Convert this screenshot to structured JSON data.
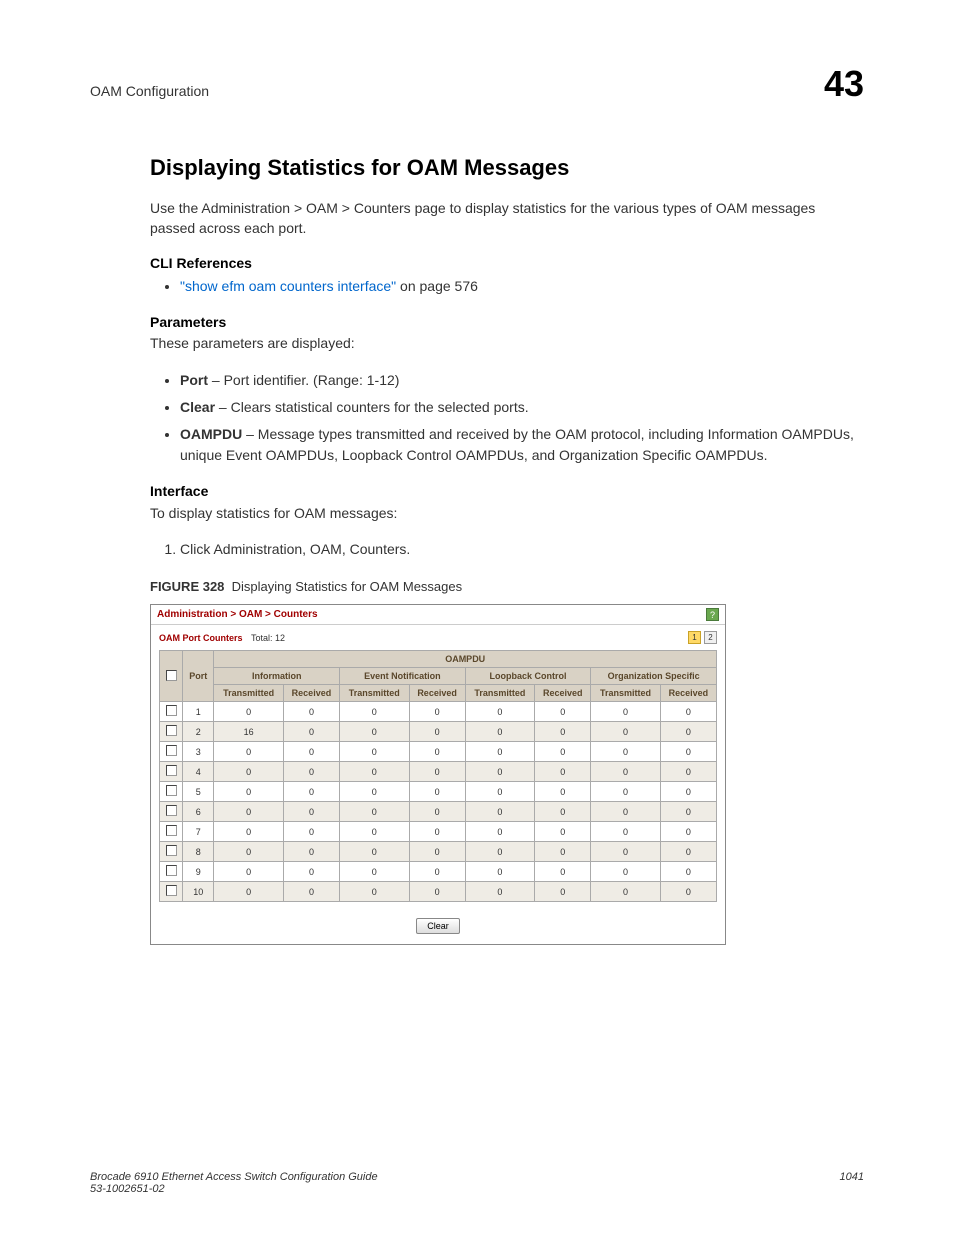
{
  "header": {
    "section": "OAM Configuration",
    "chapter": "43"
  },
  "title": "Displaying Statistics for OAM Messages",
  "intro": "Use the Administration > OAM > Counters page to display statistics for the various types of OAM messages passed across each port.",
  "cli": {
    "heading": "CLI References",
    "link": "\"show efm oam counters interface\"",
    "suffix": " on page 576"
  },
  "params": {
    "heading": "Parameters",
    "intro": "These parameters are displayed:",
    "items": [
      {
        "name": "Port",
        "desc": " – Port identifier. (Range: 1-12)"
      },
      {
        "name": "Clear",
        "desc": " – Clears statistical counters for the selected ports."
      },
      {
        "name": "OAMPDU",
        "desc": " – Message types transmitted and received by the OAM protocol, including Information OAMPDUs, unique Event OAMPDUs, Loopback Control OAMPDUs, and Organization Specific OAMPDUs."
      }
    ]
  },
  "interface": {
    "heading": "Interface",
    "intro": "To display statistics for OAM messages:",
    "steps": [
      "Click Administration, OAM, Counters."
    ]
  },
  "figure": {
    "label": "FIGURE 328",
    "caption": "Displaying Statistics for OAM Messages",
    "breadcrumb": "Administration > OAM > Counters",
    "help": "?",
    "countersLabel": "OAM Port Counters",
    "totalLabel": "Total: 12",
    "pageBadges": [
      "1",
      "2"
    ],
    "headers": {
      "oampdu": "OAMPDU",
      "port": "Port",
      "groups": [
        "Information",
        "Event Notification",
        "Loopback Control",
        "Organization Specific"
      ],
      "sub": [
        "Transmitted",
        "Received"
      ]
    },
    "rows": [
      {
        "port": "1",
        "v": [
          "0",
          "0",
          "0",
          "0",
          "0",
          "0",
          "0",
          "0"
        ]
      },
      {
        "port": "2",
        "v": [
          "16",
          "0",
          "0",
          "0",
          "0",
          "0",
          "0",
          "0"
        ]
      },
      {
        "port": "3",
        "v": [
          "0",
          "0",
          "0",
          "0",
          "0",
          "0",
          "0",
          "0"
        ]
      },
      {
        "port": "4",
        "v": [
          "0",
          "0",
          "0",
          "0",
          "0",
          "0",
          "0",
          "0"
        ]
      },
      {
        "port": "5",
        "v": [
          "0",
          "0",
          "0",
          "0",
          "0",
          "0",
          "0",
          "0"
        ]
      },
      {
        "port": "6",
        "v": [
          "0",
          "0",
          "0",
          "0",
          "0",
          "0",
          "0",
          "0"
        ]
      },
      {
        "port": "7",
        "v": [
          "0",
          "0",
          "0",
          "0",
          "0",
          "0",
          "0",
          "0"
        ]
      },
      {
        "port": "8",
        "v": [
          "0",
          "0",
          "0",
          "0",
          "0",
          "0",
          "0",
          "0"
        ]
      },
      {
        "port": "9",
        "v": [
          "0",
          "0",
          "0",
          "0",
          "0",
          "0",
          "0",
          "0"
        ]
      },
      {
        "port": "10",
        "v": [
          "0",
          "0",
          "0",
          "0",
          "0",
          "0",
          "0",
          "0"
        ]
      }
    ],
    "clearBtn": "Clear"
  },
  "footer": {
    "title": "Brocade 6910 Ethernet Access Switch Configuration Guide",
    "doc": "53-1002651-02",
    "page": "1041"
  }
}
